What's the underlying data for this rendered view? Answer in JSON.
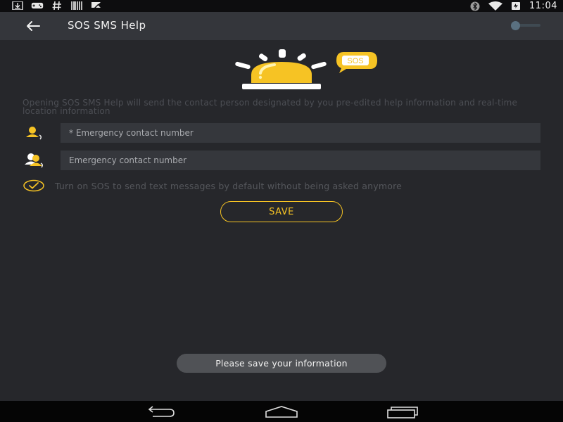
{
  "status_bar": {
    "time": "11:04",
    "left_icons": [
      "download-icon",
      "gamepad-icon",
      "hash-icon",
      "barcode-icon",
      "flag-icon"
    ],
    "right_icons": [
      "bluetooth-icon",
      "wifi-icon",
      "battery-icon"
    ]
  },
  "app_bar": {
    "title": "SOS SMS Help",
    "back_icon": "arrow-left-icon",
    "toggle_state": "off"
  },
  "hero": {
    "badge_text": "SOS",
    "accent_color": "#f6c324"
  },
  "description": "Opening SOS SMS Help will send the contact person designated by you pre-edited help information and real-time location information",
  "contacts": {
    "primary_placeholder": "* Emergency contact number",
    "secondary_placeholder": "Emergency contact number",
    "primary_value": "",
    "secondary_value": ""
  },
  "auto_send": {
    "label": "Turn on SOS to send text messages by default without being asked anymore",
    "checked": true
  },
  "save_label": "SAVE",
  "toast": "Please save your information",
  "nav_bar": {
    "icons": [
      "back-nav-icon",
      "home-nav-icon",
      "recents-nav-icon"
    ]
  }
}
